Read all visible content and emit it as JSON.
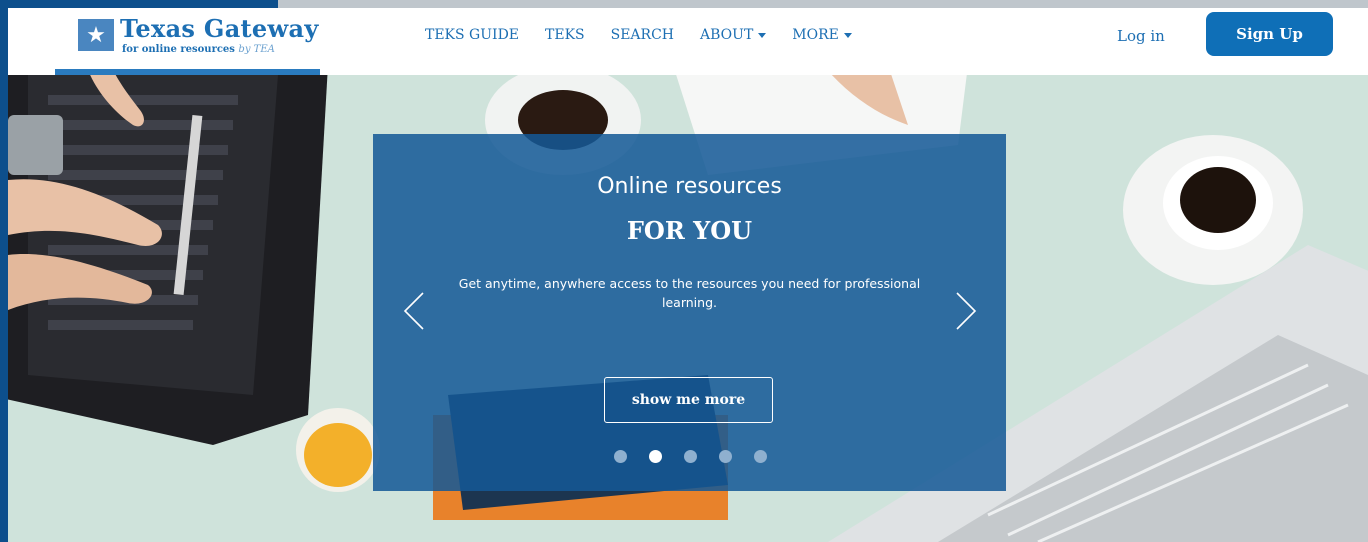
{
  "brand": {
    "name": "Texas Gateway",
    "tagline_main": "for online resources",
    "tagline_by": "by TEA"
  },
  "nav": {
    "items": [
      {
        "label": "TEKS GUIDE",
        "dropdown": false
      },
      {
        "label": "TEKS",
        "dropdown": false
      },
      {
        "label": "SEARCH",
        "dropdown": false
      },
      {
        "label": "ABOUT",
        "dropdown": true
      },
      {
        "label": "MORE",
        "dropdown": true
      }
    ],
    "login_label": "Log in",
    "signup_label": "Sign Up"
  },
  "hero": {
    "title": "Online resources",
    "subtitle": "FOR YOU",
    "text": "Get anytime, anywhere access to the resources you need for professional learning.",
    "button_label": "show me more",
    "slide_count": 5,
    "active_slide": 2
  },
  "colors": {
    "brand_blue": "#1d6fb3",
    "frame_blue": "#0d4f8c",
    "slide_overlay": "#14589a",
    "signup_bg": "#0f6fb7"
  }
}
